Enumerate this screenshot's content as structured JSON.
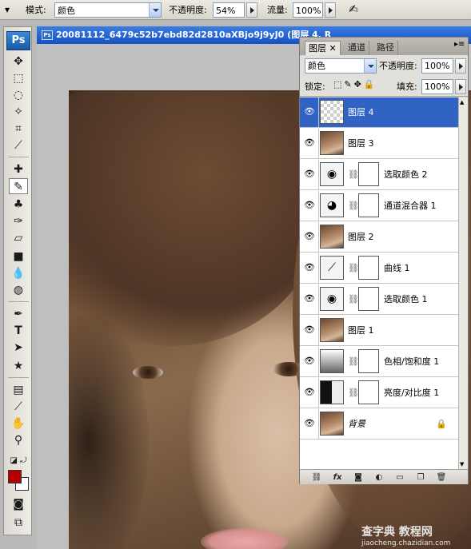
{
  "options_bar": {
    "mode_label": "模式:",
    "mode_value": "颜色",
    "opacity_label": "不透明度:",
    "opacity_value": "54%",
    "flow_label": "流量:",
    "flow_value": "100%"
  },
  "toolbox": {
    "logo": "Ps"
  },
  "document": {
    "title": "20081112_6479c52b7ebd82d2810aXBjo9j9yJ0",
    "title_suffix": "(图层 4, R"
  },
  "layers_panel": {
    "tabs": [
      "图层",
      "通道",
      "路径"
    ],
    "blend_mode": "颜色",
    "opacity_label": "不透明度:",
    "opacity_value": "100%",
    "lock_label": "锁定:",
    "fill_label": "填充:",
    "fill_value": "100%",
    "layers": [
      {
        "name": "图层 4",
        "kind": "transparent",
        "selected": true
      },
      {
        "name": "图层 3",
        "kind": "photo"
      },
      {
        "name": "选取颜色 2",
        "kind": "adjustment"
      },
      {
        "name": "通道混合器 1",
        "kind": "adjustment"
      },
      {
        "name": "图层 2",
        "kind": "photo"
      },
      {
        "name": "曲线 1",
        "kind": "adjustment"
      },
      {
        "name": "选取颜色 1",
        "kind": "adjustment"
      },
      {
        "name": "图层 1",
        "kind": "photo"
      },
      {
        "name": "色相/饱和度 1",
        "kind": "adjustment"
      },
      {
        "name": "亮度/对比度 1",
        "kind": "adjustment"
      },
      {
        "name": "背景",
        "kind": "background"
      }
    ]
  },
  "watermark": {
    "line1": "查字典 教程网",
    "line2": "jiaocheng.chazidian.com"
  },
  "colors": {
    "foreground": "#b30000",
    "background": "#ffffff",
    "selection": "#3163c5"
  }
}
